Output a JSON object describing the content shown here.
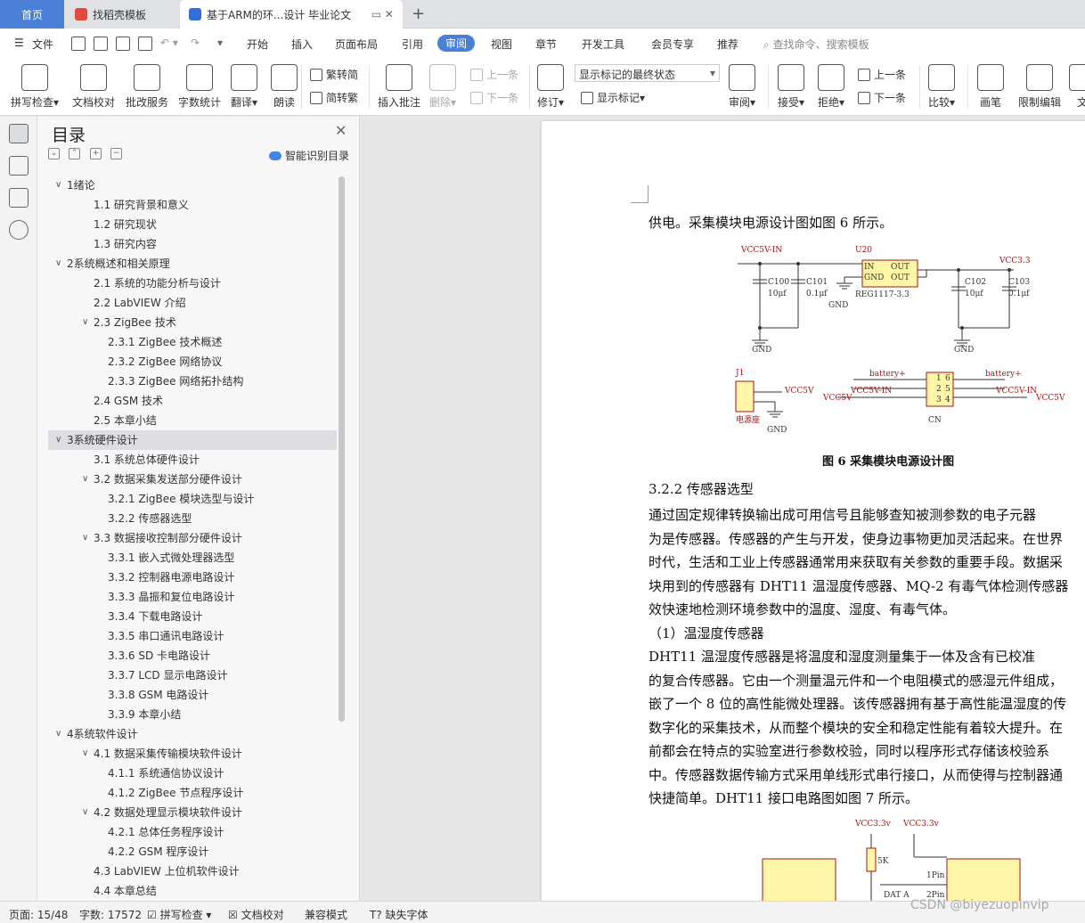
{
  "tabs": {
    "home": "首页",
    "template": "找稻壳模板",
    "document": "基于ARM的环...设计 毕业论文"
  },
  "menu": {
    "file": "文件",
    "items": [
      "开始",
      "插入",
      "页面布局",
      "引用",
      "审阅",
      "视图",
      "章节",
      "开发工具",
      "会员专享",
      "推荐"
    ],
    "active": "审阅",
    "search": "查找命令、搜索模板"
  },
  "ribbon": {
    "spell": "拼写检查",
    "proof": "文档校对",
    "batch": "批改服务",
    "wordcount": "字数统计",
    "translate": "翻译",
    "read": "朗读",
    "trad": "繁转简",
    "simp": "简转繁",
    "insert_comment": "插入批注",
    "delete": "删除",
    "prev_comment": "上一条",
    "next_comment": "下一条",
    "revise": "修订",
    "markup_state": "显示标记的最终状态",
    "show_markup": "显示标记",
    "review": "审阅",
    "accept": "接受",
    "reject": "拒绝",
    "prev": "上一条",
    "next": "下一条",
    "compare": "比较",
    "pen": "画笔",
    "restrict": "限制编辑",
    "doc": "文"
  },
  "nav": {
    "title": "目录",
    "smart": "智能识别目录"
  },
  "toc": [
    {
      "label": "1绪论",
      "level": 0,
      "caret": true
    },
    {
      "label": "1.1    研究背景和意义",
      "level": 1
    },
    {
      "label": "1.2    研究现状",
      "level": 1
    },
    {
      "label": "1.3    研究内容",
      "level": 1
    },
    {
      "label": "2系统概述和相关原理",
      "level": 0,
      "caret": true
    },
    {
      "label": "2.1    系统的功能分析与设计",
      "level": 1
    },
    {
      "label": "2.2    LabVIEW 介绍",
      "level": 1
    },
    {
      "label": "2.3    ZigBee 技术",
      "level": 1,
      "caret": true
    },
    {
      "label": "2.3.1 ZigBee 技术概述",
      "level": 2
    },
    {
      "label": "2.3.2 ZigBee 网络协议",
      "level": 2
    },
    {
      "label": "2.3.3 ZigBee 网络拓扑结构",
      "level": 2
    },
    {
      "label": "2.4    GSM 技术",
      "level": 1
    },
    {
      "label": "2.5    本章小结",
      "level": 1
    },
    {
      "label": "3系统硬件设计",
      "level": 0,
      "caret": true,
      "selected": true
    },
    {
      "label": "3.1    系统总体硬件设计",
      "level": 1
    },
    {
      "label": "3.2    数据采集发送部分硬件设计",
      "level": 1,
      "caret": true
    },
    {
      "label": "3.2.1    ZigBee 模块选型与设计",
      "level": 2
    },
    {
      "label": "3.2.2    传感器选型",
      "level": 2
    },
    {
      "label": "3.3    数据接收控制部分硬件设计",
      "level": 1,
      "caret": true
    },
    {
      "label": "3.3.1    嵌入式微处理器选型",
      "level": 2
    },
    {
      "label": "3.3.2    控制器电源电路设计",
      "level": 2
    },
    {
      "label": "3.3.3    晶振和复位电路设计",
      "level": 2
    },
    {
      "label": "3.3.4    下载电路设计",
      "level": 2
    },
    {
      "label": "3.3.5    串口通讯电路设计",
      "level": 2
    },
    {
      "label": "3.3.6    SD 卡电路设计",
      "level": 2
    },
    {
      "label": "3.3.7    LCD 显示电路设计",
      "level": 2
    },
    {
      "label": "3.3.8    GSM 电路设计",
      "level": 2
    },
    {
      "label": "3.3.9    本章小结",
      "level": 2
    },
    {
      "label": "4系统软件设计",
      "level": 0,
      "caret": true
    },
    {
      "label": "4.1    数据采集传输模块软件设计",
      "level": 1,
      "caret": true
    },
    {
      "label": "4.1.1    系统通信协议设计",
      "level": 2
    },
    {
      "label": "4.1.2    ZigBee 节点程序设计",
      "level": 2
    },
    {
      "label": "4.2    数据处理显示模块软件设计",
      "level": 1,
      "caret": true
    },
    {
      "label": "4.2.1    总体任务程序设计",
      "level": 2
    },
    {
      "label": "4.2.2    GSM 程序设计",
      "level": 2
    },
    {
      "label": "4.3    LabVIEW 上位机软件设计",
      "level": 1
    },
    {
      "label": "4.4    本章总结",
      "level": 1
    }
  ],
  "document": {
    "line_top": "供电。采集模块电源设计图如图 6 所示。",
    "fig6_caption": "图 6    采集模块电源设计图",
    "heading": "3.2.2    传感器选型",
    "paragraphs": [
      "      通过固定规律转换输出成可用信号且能够查知被测参数的电子元器",
      "为是传感器。传感器的产生与开发，使身边事物更加灵活起来。在世界",
      "时代，生活和工业上传感器通常用来获取有关参数的重要手段。数据采",
      "块用到的传感器有 DHT11 温湿度传感器、MQ-2 有毒气体检测传感器",
      "效快速地检测环境参数中的温度、湿度、有毒气体。",
      "        （1）温湿度传感器",
      "      DHT11 温湿度传感器是将温度和湿度测量集于一体及含有已校准",
      "的复合传感器。它由一个测量温元件和一个电阻模式的感湿元件组成，",
      "嵌了一个 8 位的高性能微处理器。该传感器拥有基于高性能温湿度的传",
      "数字化的采集技术，从而整个模块的安全和稳定性能有着较大提升。在",
      "前都会在特点的实验室进行参数校验，同时以程序形式存储该校验系",
      "中。传感器数据传输方式采用单线形式串行接口，从而使得与控制器通",
      "快捷简单。DHT11 接口电路图如图 7 所示。"
    ],
    "schematic": {
      "vcc5v_in": "VCC5V-IN",
      "u20": "U20",
      "in": "IN",
      "gnd_pin": "GND",
      "out": "OUT",
      "reg": "REG1117-3.3",
      "c100": "C100",
      "c100v": "10μf",
      "c101": "C101",
      "c101v": "0.1μf",
      "c102": "C102",
      "c102v": "10μf",
      "c103": "C103",
      "c103v": "0.1μf",
      "vcc33": "VCC3.3",
      "gnd": "GND",
      "j1": "J1",
      "power_socket": "电源座",
      "vcc5v": "VCC5V",
      "battery": "battery+",
      "cn": "CN",
      "pin1": "1",
      "pin2": "2",
      "pin3": "3",
      "pin4": "4",
      "pin5": "5",
      "pin6": "6"
    },
    "fig7": {
      "vcc_a": "VCC3.3v",
      "vcc_b": "VCC3.3v",
      "r": "5K",
      "data": "DAT A",
      "p1": "1Pin",
      "p2": "2Pin"
    }
  },
  "status": {
    "page": "页面: 15/48",
    "words": "字数: 17572",
    "spell": "拼写检查",
    "proof": "文档校对",
    "compat": "兼容模式",
    "font": "缺失字体"
  },
  "watermark": "CSDN @biyezuopinvip",
  "colors": {
    "accent": "#4a7fd6",
    "schematic_red": "#a01818",
    "component_fill": "#fff6a8"
  }
}
